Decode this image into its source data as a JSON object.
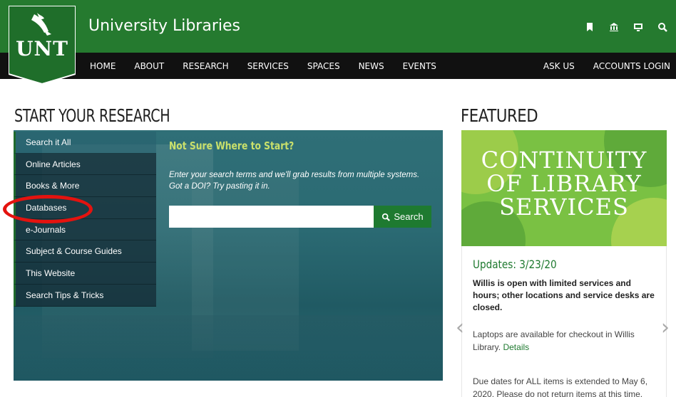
{
  "header": {
    "logo_text": "UNT",
    "site_title": "University Libraries",
    "icons": [
      "bookmark-icon",
      "library-icon",
      "computer-icon",
      "search-icon"
    ]
  },
  "nav": {
    "left": [
      "HOME",
      "ABOUT",
      "RESEARCH",
      "SERVICES",
      "SPACES",
      "NEWS",
      "EVENTS"
    ],
    "right": [
      "ASK US",
      "ACCOUNTS LOGIN"
    ]
  },
  "research": {
    "heading": "START YOUR RESEARCH",
    "tabs": [
      "Search it All",
      "Online Articles",
      "Books & More",
      "Databases",
      "e-Journals",
      "Subject & Course Guides",
      "This Website",
      "Search Tips & Tricks"
    ],
    "active_tab": "Search it All",
    "title": "Not Sure Where to Start?",
    "description": "Enter your search terms and we'll grab results from multiple systems. Got a DOI? Try pasting it in.",
    "search_value": "",
    "search_button": "Search"
  },
  "featured": {
    "heading": "FEATURED",
    "image_text": "CONTINUITY OF LIBRARY SERVICES",
    "updates_title": "Updates: 3/23/20",
    "bold_text": "Willis is open with limited services and hours; other locations and service desks are closed.",
    "para1": "Laptops are available for checkout in Willis Library.",
    "para1_link": "Details",
    "para2": "Due dates for ALL items is extended to May 6, 2020. Please do not return items at this time."
  },
  "colors": {
    "brand_green": "#257a2f",
    "nav_bg": "#111111",
    "accent_title": "#c9e06b",
    "annotation_red": "#e4130f",
    "featured_green": "#7ac143"
  }
}
